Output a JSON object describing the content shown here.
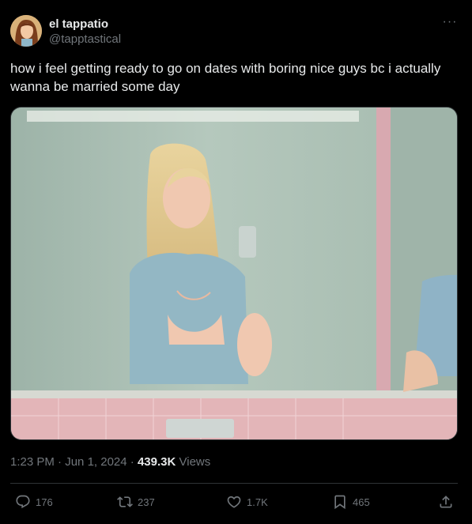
{
  "author": {
    "display_name": "el tappatio",
    "handle": "@tapptastical"
  },
  "tweet": {
    "text": "how i feel getting ready to go on dates with boring nice guys bc i actually wanna be married some day",
    "time": "1:23 PM",
    "separator": "·",
    "date": "Jun 1, 2024",
    "views_count": "439.3K",
    "views_label": "Views"
  },
  "actions": {
    "replies": "176",
    "reposts": "237",
    "likes": "1.7K",
    "bookmarks": "465"
  },
  "icons": {
    "more": "more-icon",
    "reply": "reply-icon",
    "repost": "repost-icon",
    "like": "heart-icon",
    "bookmark": "bookmark-icon",
    "share": "share-icon"
  },
  "colors": {
    "background": "#000000",
    "text": "#e7e9ea",
    "secondary": "#71767b",
    "divider": "#2f3336"
  }
}
